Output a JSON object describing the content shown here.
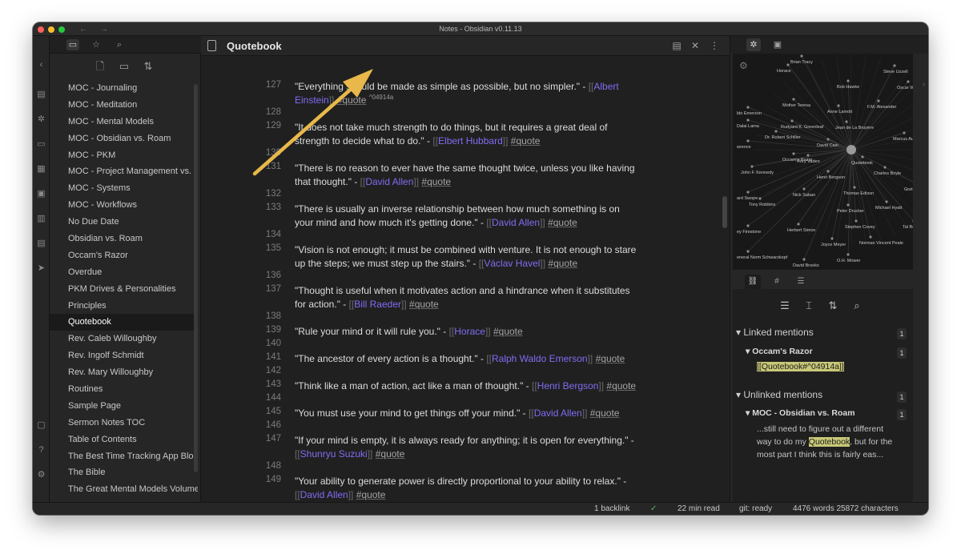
{
  "window": {
    "title": "Notes - Obsidian v0.11.13"
  },
  "left_sidebar": {
    "tabs": [
      "file-explorer",
      "starred",
      "search"
    ],
    "actions": [
      "new-note",
      "new-folder",
      "sort"
    ],
    "files": [
      "MOC - Journaling",
      "MOC - Meditation",
      "MOC - Mental Models",
      "MOC - Obsidian vs. Roam",
      "MOC - PKM",
      "MOC - Project Management vs. T",
      "MOC - Systems",
      "MOC - Workflows",
      "No Due Date",
      "Obsidian vs. Roam",
      "Occam's Razor",
      "Overdue",
      "PKM Drives & Personalities",
      "Principles",
      "Quotebook",
      "Rev. Caleb Willoughby",
      "Rev. Ingolf Schmidt",
      "Rev. Mary Willoughby",
      "Routines",
      "Sample Page",
      "Sermon Notes TOC",
      "Table of Contents",
      "The Best Time Tracking App Blog",
      "The Bible",
      "The Great Mental Models Volume"
    ],
    "active_file": "Quotebook"
  },
  "editor": {
    "title": "Quotebook",
    "lines": [
      {
        "n": "127",
        "quote": "\"Everything should be made as simple as possible, but no simpler.\" - ",
        "link": "Albert Einstein",
        "tag": "#quote",
        "blockid": "^04914a"
      },
      {
        "n": "128"
      },
      {
        "n": "129",
        "quote": "\"It does not take much strength to do things, but it requires a great deal of strength to decide what to do.\" - ",
        "link": "Elbert Hubbard",
        "tag": "#quote"
      },
      {
        "n": "130"
      },
      {
        "n": "131",
        "quote": "\"There is no reason to ever have the same thought twice, unless you like having that thought.\" - ",
        "link": "David Allen",
        "tag": "#quote"
      },
      {
        "n": "132"
      },
      {
        "n": "133",
        "quote": "\"There is usually an inverse relationship between how much something is on your mind and how much it's getting done.\" - ",
        "link": "David Allen",
        "tag": "#quote"
      },
      {
        "n": "134"
      },
      {
        "n": "135",
        "quote": "\"Vision is not enough; it must be combined with venture. It is not enough to stare up the steps; we must step up the stairs.\" - ",
        "link": "Václav Havel",
        "tag": "#quote"
      },
      {
        "n": "136"
      },
      {
        "n": "137",
        "quote": "\"Thought is useful when it motivates action and a hindrance when it substitutes for action.\" - ",
        "link": "Bill Raeder",
        "tag": "#quote"
      },
      {
        "n": "138"
      },
      {
        "n": "139",
        "quote": "\"Rule your mind or it will rule you.\" - ",
        "link": "Horace",
        "tag": "#quote"
      },
      {
        "n": "140"
      },
      {
        "n": "141",
        "quote": "\"The ancestor of every action is a thought.\" - ",
        "link": "Ralph Waldo Emerson",
        "tag": "#quote"
      },
      {
        "n": "142"
      },
      {
        "n": "143",
        "quote": "\"Think like a man of action, act like a man of thought.\" - ",
        "link": "Henri Bergson",
        "tag": "#quote"
      },
      {
        "n": "144"
      },
      {
        "n": "145",
        "quote": "\"You must use your mind to get things off your mind.\" - ",
        "link": "David Allen",
        "tag": "#quote"
      },
      {
        "n": "146"
      },
      {
        "n": "147",
        "quote": "\"If your mind is empty, it is always ready for anything; it is open for everything.\" - ",
        "link": "Shunryu Suzuki",
        "tag": "#quote"
      },
      {
        "n": "148"
      },
      {
        "n": "149",
        "quote": "\"Your ability to generate power is directly proportional to your ability to relax.\" - ",
        "link": "David Allen",
        "tag": "#quote"
      }
    ]
  },
  "graph": {
    "center": "Quotebook",
    "nodes": [
      "Brian Tracy",
      "Horace",
      "Steve Uzzell",
      "Bob Hawke",
      "Oscar Wi",
      "ldo Emerson",
      "Mother Teresa",
      "Anne Lamott",
      "F.M. Alexander",
      "Dalai Lama",
      "Rudyard K. Greenleaf",
      "Jean de La Bruyère",
      "Dr. Robert Schiller",
      "David Cain",
      "Marcus Aure",
      "wrence",
      "Occam's Razor",
      "Quotebook",
      "John F. Kennedy",
      "Rory Vaden",
      "Charles Boyle",
      "Henri Bergson",
      "Gretchen",
      "Thomas Edison",
      "Nick Saban",
      "Peter Drucker",
      "Michael Hyatt",
      "ard Swope",
      "Tony Robbins",
      "Stephen Covey",
      "Tal Ben-",
      "ey Firestone",
      "Herbert Simon",
      "Norman Vincent Peale",
      "Joyce Meyer",
      "eneral Norm Schwarzkopf",
      "O.H. Mower",
      "David Brooks"
    ]
  },
  "backlinks": {
    "linked_title": "Linked mentions",
    "linked_count": "1",
    "linked_source": "Occam's Razor",
    "linked_source_count": "1",
    "linked_snippet": "[[Quotebook#^04914a]]",
    "unlinked_title": "Unlinked mentions",
    "unlinked_count": "1",
    "unlinked_source": "MOC - Obsidian vs. Roam",
    "unlinked_source_count": "1",
    "unlinked_before": "...still need to figure out a different way to do my ",
    "unlinked_highlight": "Quotebook",
    "unlinked_after": ", but for the most part I think this is fairly eas..."
  },
  "status": {
    "backlinks": "1 backlink",
    "read_time": "22 min read",
    "git": "git: ready",
    "counts": "4476 words 25872 characters"
  },
  "annotation": {
    "color": "#e8b84a"
  }
}
